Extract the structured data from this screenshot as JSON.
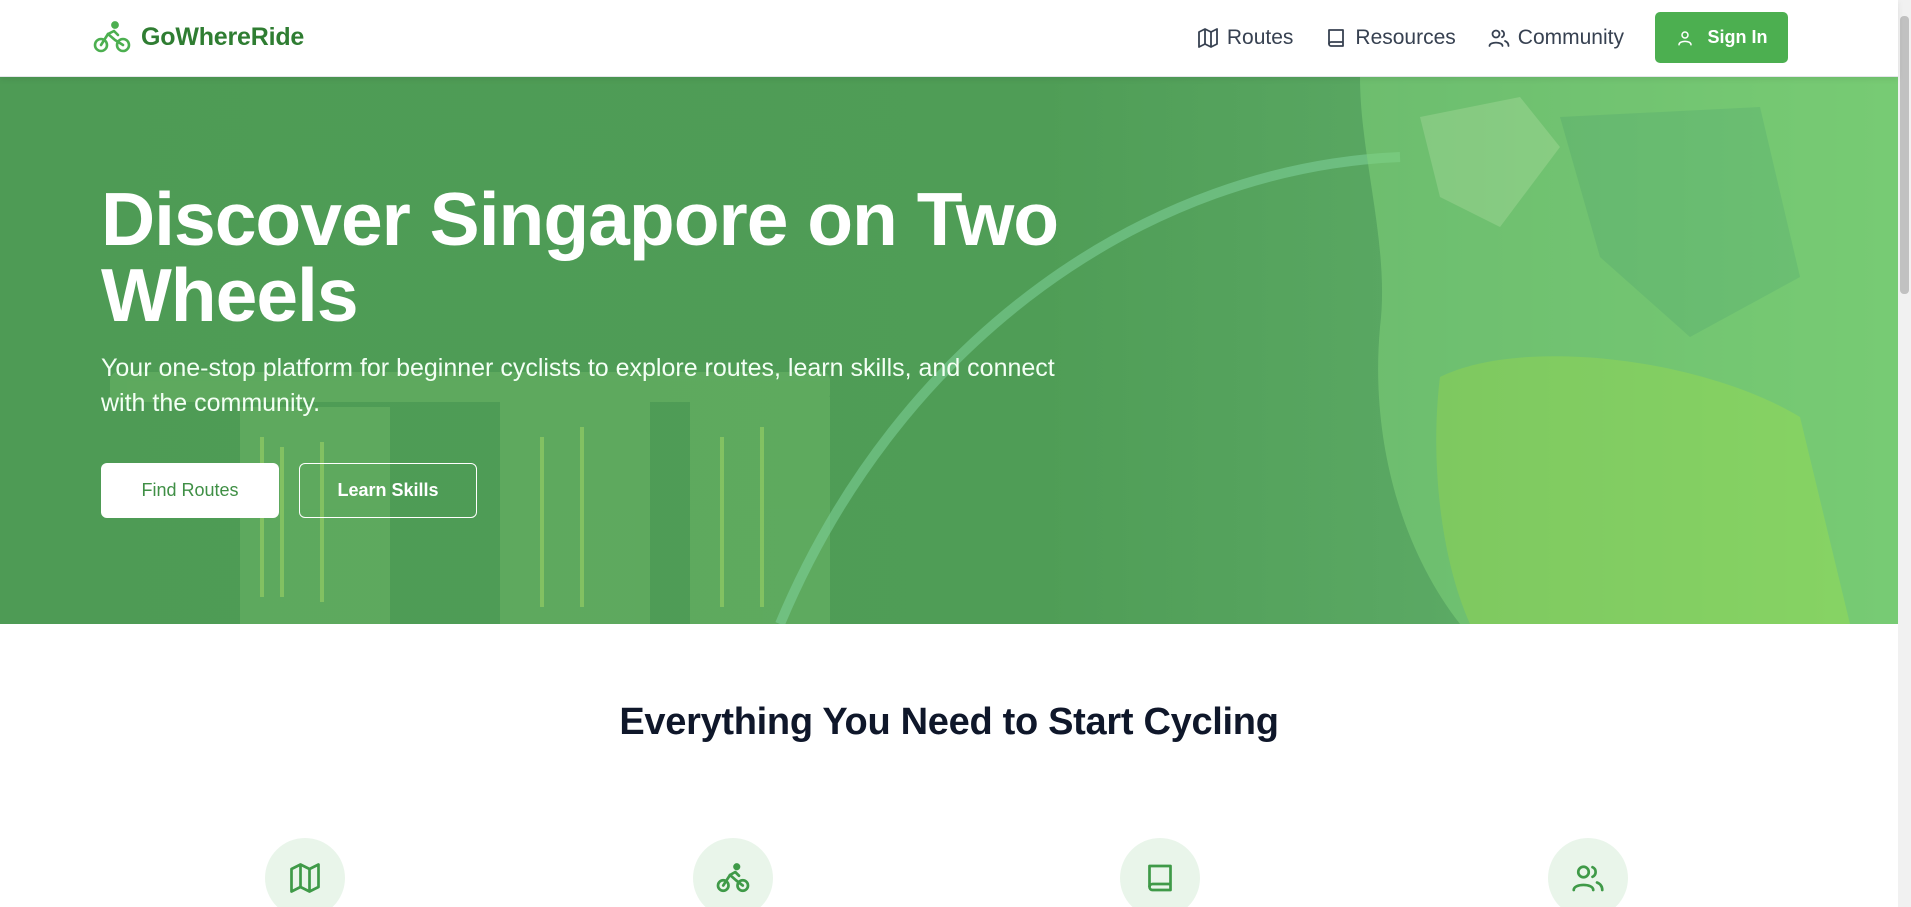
{
  "brand": {
    "name": "GoWhereRide",
    "icon": "bike-icon",
    "color": "#2f7d32"
  },
  "nav": {
    "items": [
      {
        "label": "Routes",
        "icon": "map-icon"
      },
      {
        "label": "Resources",
        "icon": "book-icon"
      },
      {
        "label": "Community",
        "icon": "users-icon"
      }
    ],
    "signin_label": "Sign In",
    "signin_icon": "user-icon"
  },
  "hero": {
    "title": "Discover Singapore on Two Wheels",
    "subtitle": "Your one-stop platform for beginner cyclists to explore routes, learn skills, and connect with the community.",
    "primary_button": "Find Routes",
    "secondary_button": "Learn Skills"
  },
  "features": {
    "title": "Everything You Need to Start Cycling",
    "icons": [
      "map-icon",
      "bike-icon",
      "book-icon",
      "users-icon"
    ]
  },
  "colors": {
    "accent": "#4caf50",
    "hero_green": "#4f9d56",
    "feature_bg": "#e9f5ea"
  }
}
